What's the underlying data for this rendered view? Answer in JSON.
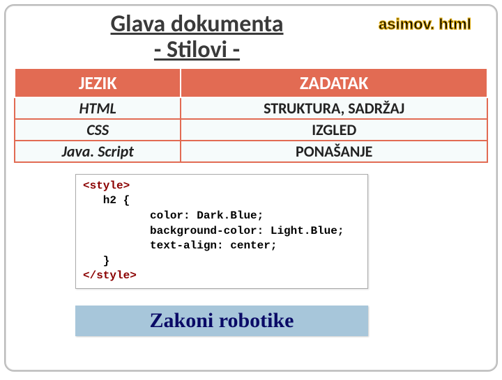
{
  "title": {
    "line1": "Glava dokumenta",
    "line2": "- Stilovi -"
  },
  "filename": "asimov. html",
  "table": {
    "headers": {
      "col1": "JEZIK",
      "col2": "ZADATAK"
    },
    "rows": [
      {
        "lang": "HTML",
        "task": "STRUKTURA, SADRŽAJ"
      },
      {
        "lang": "CSS",
        "task": "IZGLED"
      },
      {
        "lang": "Java. Script",
        "task": "PONAŠANJE"
      }
    ]
  },
  "code": {
    "open": "<style>",
    "selector_open": "   h2 {",
    "l1": "          color: Dark.Blue;",
    "l2": "          background-color: Light.Blue;",
    "l3": "          text-align: center;",
    "selector_close": "   }",
    "close": "</style>"
  },
  "demo": {
    "text": "Zakoni robotike"
  }
}
